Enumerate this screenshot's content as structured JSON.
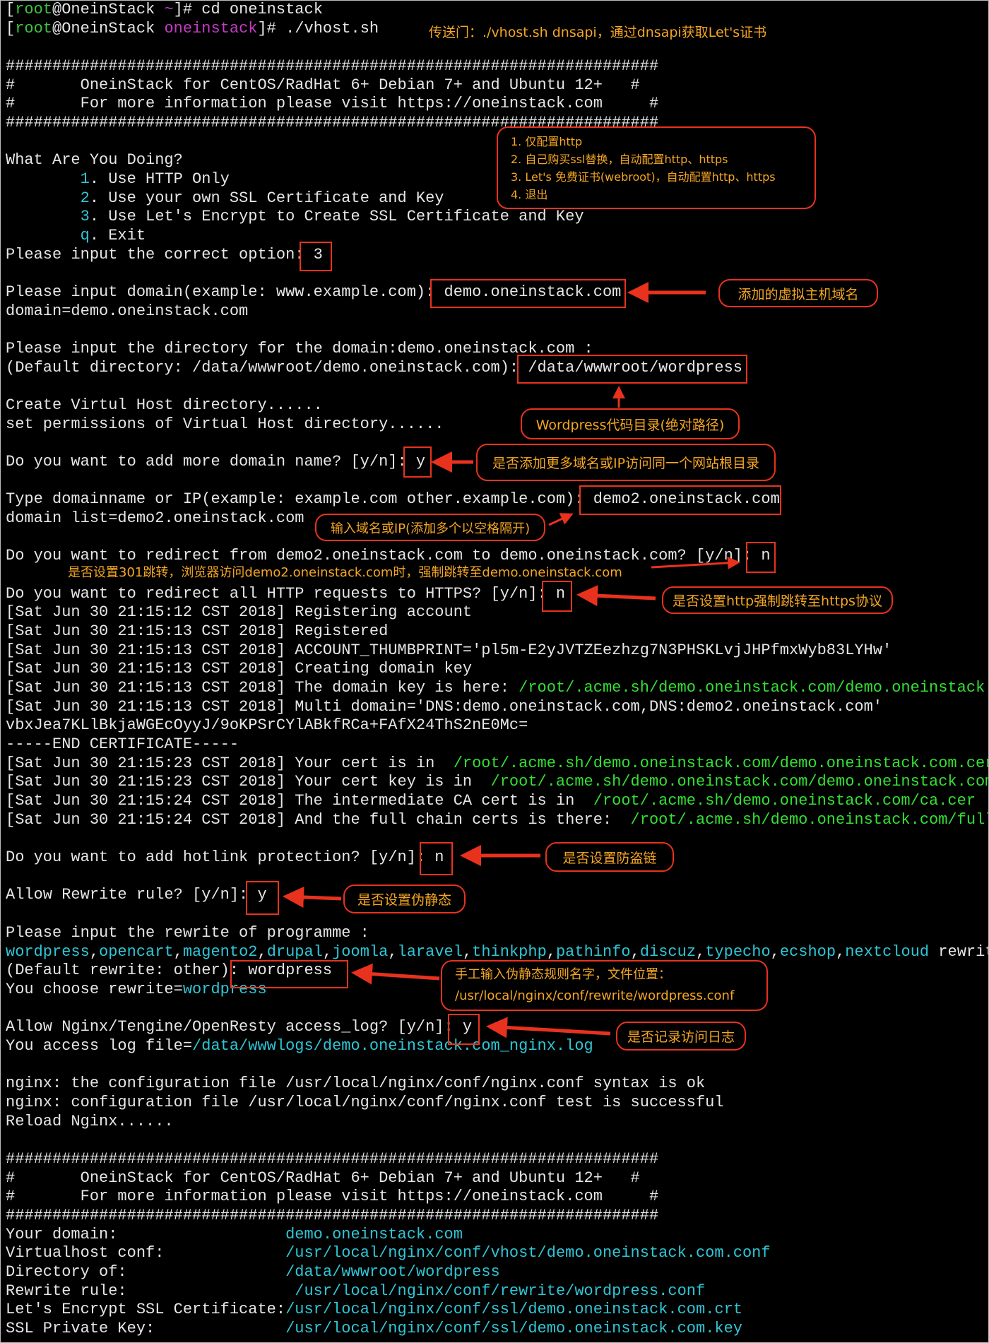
{
  "terminal": {
    "lines": [
      [
        {
          "t": "["
        },
        {
          "t": "root",
          "c": "g"
        },
        {
          "t": "@OneinStack "
        },
        {
          "t": "~",
          "c": "m"
        },
        {
          "t": "]# cd oneinstack"
        }
      ],
      [
        {
          "t": "["
        },
        {
          "t": "root",
          "c": "g"
        },
        {
          "t": "@OneinStack "
        },
        {
          "t": "oneinstack",
          "c": "m"
        },
        {
          "t": "]# ./vhost.sh"
        }
      ],
      [],
      [
        {
          "t": "######################################################################"
        }
      ],
      [
        {
          "t": "#       OneinStack for CentOS/RadHat 6+ Debian 7+ and Ubuntu 12+   #"
        }
      ],
      [
        {
          "t": "#       For more information please visit https://oneinstack.com     #"
        }
      ],
      [
        {
          "t": "######################################################################"
        }
      ],
      [],
      [
        {
          "t": "What Are You Doing?"
        }
      ],
      [
        {
          "t": "        "
        },
        {
          "t": "1",
          "c": "c"
        },
        {
          "t": ". Use HTTP Only"
        }
      ],
      [
        {
          "t": "        "
        },
        {
          "t": "2",
          "c": "c"
        },
        {
          "t": ". Use your own SSL Certificate and Key"
        }
      ],
      [
        {
          "t": "        "
        },
        {
          "t": "3",
          "c": "c"
        },
        {
          "t": ". Use Let's Encrypt to Create SSL Certificate and Key"
        }
      ],
      [
        {
          "t": "        "
        },
        {
          "t": "q",
          "c": "c"
        },
        {
          "t": ". Exit"
        }
      ],
      [
        {
          "t": "Please input the correct option: 3"
        }
      ],
      [],
      [
        {
          "t": "Please input domain(example: www.example.com): demo.oneinstack.com"
        }
      ],
      [
        {
          "t": "domain=demo.oneinstack.com"
        }
      ],
      [],
      [
        {
          "t": "Please input the directory for the domain:demo.oneinstack.com :"
        }
      ],
      [
        {
          "t": "(Default directory: /data/wwwroot/demo.oneinstack.com): /data/wwwroot/wordpress"
        }
      ],
      [],
      [
        {
          "t": "Create Virtul Host directory......"
        }
      ],
      [
        {
          "t": "set permissions of Virtual Host directory......"
        }
      ],
      [],
      [
        {
          "t": "Do you want to add more domain name? [y/n]: y"
        }
      ],
      [],
      [
        {
          "t": "Type domainname or IP(example: example.com other.example.com): demo2.oneinstack.com"
        }
      ],
      [
        {
          "t": "domain list=demo2.oneinstack.com"
        }
      ],
      [],
      [
        {
          "t": "Do you want to redirect from demo2.oneinstack.com to demo.oneinstack.com? [y/n]: n"
        }
      ],
      [],
      [
        {
          "t": "Do you want to redirect all HTTP requests to HTTPS? [y/n]: n"
        }
      ],
      [
        {
          "t": "[Sat Jun 30 21:15:12 CST 2018] Registering account"
        }
      ],
      [
        {
          "t": "[Sat Jun 30 21:15:13 CST 2018] Registered"
        }
      ],
      [
        {
          "t": "[Sat Jun 30 21:15:13 CST 2018] ACCOUNT_THUMBPRINT='pl5m-E2yJVTZEezhzg7N3PHSKLvjJHPfmxWyb83LYHw'"
        }
      ],
      [
        {
          "t": "[Sat Jun 30 21:15:13 CST 2018] Creating domain key"
        }
      ],
      [
        {
          "t": "[Sat Jun 30 21:15:13 CST 2018] The domain key is here: "
        },
        {
          "t": "/root/.acme.sh/demo.oneinstack.com/demo.oneinstack.c",
          "c": "b"
        }
      ],
      [
        {
          "t": "[Sat Jun 30 21:15:13 CST 2018] Multi domain='DNS:demo.oneinstack.com,DNS:demo2.oneinstack.com'"
        }
      ],
      [
        {
          "t": "vbxJea7KLlBkjaWGEcOyyJ/9oKPSrCYlABkfRCa+FAfX24ThS2nE0Mc="
        }
      ],
      [
        {
          "t": "-----END CERTIFICATE-----"
        }
      ],
      [
        {
          "t": "[Sat Jun 30 21:15:23 CST 2018] Your cert is in  "
        },
        {
          "t": "/root/.acme.sh/demo.oneinstack.com/demo.oneinstack.com.cer",
          "c": "b"
        }
      ],
      [
        {
          "t": "[Sat Jun 30 21:15:23 CST 2018] Your cert key is in  "
        },
        {
          "t": "/root/.acme.sh/demo.oneinstack.com/demo.oneinstack.com",
          "c": "b"
        }
      ],
      [
        {
          "t": "[Sat Jun 30 21:15:24 CST 2018] The intermediate CA cert is in  "
        },
        {
          "t": "/root/.acme.sh/demo.oneinstack.com/ca.cer",
          "c": "b"
        }
      ],
      [
        {
          "t": "[Sat Jun 30 21:15:24 CST 2018] And the full chain certs is there:  "
        },
        {
          "t": "/root/.acme.sh/demo.oneinstack.com/full",
          "c": "b"
        }
      ],
      [],
      [
        {
          "t": "Do you want to add hotlink protection? [y/n]: n"
        }
      ],
      [],
      [
        {
          "t": "Allow Rewrite rule? [y/n]: y"
        }
      ],
      [],
      [
        {
          "t": "Please input the rewrite of programme :"
        }
      ],
      [
        {
          "t": "wordpress",
          "c": "c"
        },
        {
          "t": ","
        },
        {
          "t": "opencart",
          "c": "c"
        },
        {
          "t": ","
        },
        {
          "t": "magento2",
          "c": "c"
        },
        {
          "t": ","
        },
        {
          "t": "drupal",
          "c": "c"
        },
        {
          "t": ","
        },
        {
          "t": "joomla",
          "c": "c"
        },
        {
          "t": ","
        },
        {
          "t": "laravel",
          "c": "c"
        },
        {
          "t": ","
        },
        {
          "t": "thinkphp",
          "c": "c"
        },
        {
          "t": ","
        },
        {
          "t": "pathinfo",
          "c": "c"
        },
        {
          "t": ","
        },
        {
          "t": "discuz",
          "c": "c"
        },
        {
          "t": ","
        },
        {
          "t": "typecho",
          "c": "c"
        },
        {
          "t": ","
        },
        {
          "t": "ecshop",
          "c": "c"
        },
        {
          "t": ","
        },
        {
          "t": "nextcloud",
          "c": "c"
        },
        {
          "t": " rewrite"
        }
      ],
      [
        {
          "t": "(Default rewrite: other): wordpress"
        }
      ],
      [
        {
          "t": "You choose rewrite="
        },
        {
          "t": "wordpress",
          "c": "c"
        }
      ],
      [],
      [
        {
          "t": "Allow Nginx/Tengine/OpenResty access_log? [y/n]: y"
        }
      ],
      [
        {
          "t": "You access log file="
        },
        {
          "t": "/data/wwwlogs/demo.oneinstack.com_nginx.log",
          "c": "c"
        }
      ],
      [],
      [
        {
          "t": "nginx: the configuration file /usr/local/nginx/conf/nginx.conf syntax is ok"
        }
      ],
      [
        {
          "t": "nginx: configuration file /usr/local/nginx/conf/nginx.conf test is successful"
        }
      ],
      [
        {
          "t": "Reload Nginx......"
        }
      ],
      [],
      [
        {
          "t": "######################################################################"
        }
      ],
      [
        {
          "t": "#       OneinStack for CentOS/RadHat 6+ Debian 7+ and Ubuntu 12+   #"
        }
      ],
      [
        {
          "t": "#       For more information please visit https://oneinstack.com     #"
        }
      ],
      [
        {
          "t": "######################################################################"
        }
      ],
      [
        {
          "t": "Your domain:                  "
        },
        {
          "t": "demo.oneinstack.com",
          "c": "c"
        }
      ],
      [
        {
          "t": "Virtualhost conf:             "
        },
        {
          "t": "/usr/local/nginx/conf/vhost/demo.oneinstack.com.conf",
          "c": "c"
        }
      ],
      [
        {
          "t": "Directory of:                 "
        },
        {
          "t": "/data/wwwroot/wordpress",
          "c": "c"
        }
      ],
      [
        {
          "t": "Rewrite rule:                  "
        },
        {
          "t": "/usr/local/nginx/conf/rewrite/wordpress.conf",
          "c": "c"
        }
      ],
      [
        {
          "t": "Let's Encrypt SSL Certificate:"
        },
        {
          "t": "/usr/local/nginx/conf/ssl/demo.oneinstack.com.crt",
          "c": "c"
        }
      ],
      [
        {
          "t": "SSL Private Key:              "
        },
        {
          "t": "/usr/local/nginx/conf/ssl/demo.oneinstack.com.key",
          "c": "c"
        }
      ]
    ]
  },
  "annotations": {
    "teleport_note": "传送门：./vhost.sh dnsapi，通过dnsapi获取Let's证书",
    "options_list": [
      "1. 仅配置http",
      "2. 自己购买ssl替换，自动配置http、https",
      "3. Let's 免费证书(webroot)，自动配置http、https",
      "4. 退出"
    ],
    "domain": "添加的虚拟主机域名",
    "directory": "Wordpress代码目录(绝对路径)",
    "more_domain": "是否添加更多域名或IP访问同一个网站根目录",
    "domain_list": "输入域名或IP(添加多个以空格隔开)",
    "redirect_301": "是否设置301跳转，浏览器访问demo2.oneinstack.com时，强制跳转至demo.oneinstack.com",
    "https_redirect": "是否设置http强制跳转至https协议",
    "hotlink": "是否设置防盗链",
    "rewrite": "是否设置伪静态",
    "rewrite_manual": [
      "手工输入伪静态规则名字，文件位置：",
      "/usr/local/nginx/conf/rewrite/wordpress.conf"
    ],
    "access_log": "是否记录访问日志"
  },
  "colors": {
    "accent_red": "#e8321e",
    "annotation_orange": "#f5a623",
    "green": "#3ec33e",
    "cyan": "#2fc6d6",
    "magenta": "#c33bc3"
  }
}
